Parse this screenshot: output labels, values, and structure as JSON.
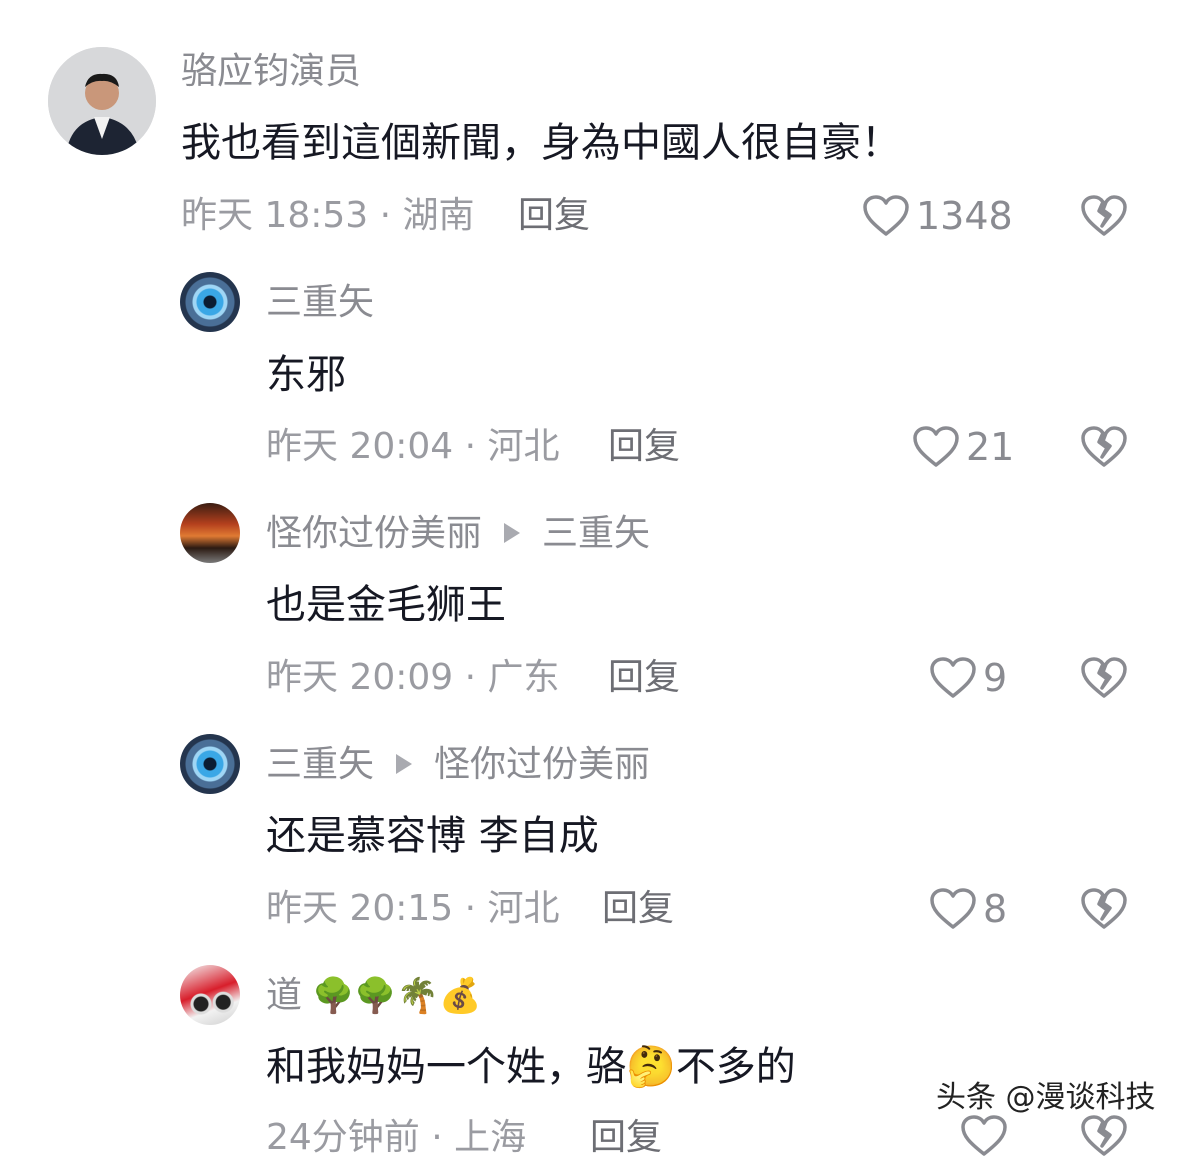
{
  "comments": [
    {
      "author": "骆应钧演员",
      "text": "我也看到這個新聞，身為中國人很自豪！",
      "time": "昨天 18:53 · 湖南",
      "reply": "回复",
      "likes": "1348",
      "avatar": "actor-avatar"
    },
    {
      "author": "三重矢",
      "text": "东邪",
      "time": "昨天 20:04 · 河北",
      "reply": "回复",
      "likes": "21",
      "avatar": "eye-avatar"
    },
    {
      "author": "怪你过份美丽",
      "reply_to": "三重矢",
      "text": "也是金毛狮王",
      "time": "昨天 20:09 · 广东",
      "reply": "回复",
      "likes": "9",
      "avatar": "tiger-avatar"
    },
    {
      "author": "三重矢",
      "reply_to": "怪你过份美丽",
      "text": "还是慕容博 李自成",
      "time": "昨天 20:15 · 河北",
      "reply": "回复",
      "likes": "8",
      "avatar": "eye-avatar"
    },
    {
      "author": "道",
      "author_emoji": "🌳🌳🌴💰",
      "text_before": "和我妈妈一个姓，骆",
      "text_emoji": "🤔",
      "text_after": "不多的",
      "time": "24分钟前 · 上海",
      "reply": "回复",
      "avatar": "motorcycle-avatar"
    }
  ],
  "watermark": "头条 @漫谈科技",
  "colors": {
    "primary_text": "#161823",
    "secondary_text": "#8a8b91",
    "background": "#ffffff"
  }
}
